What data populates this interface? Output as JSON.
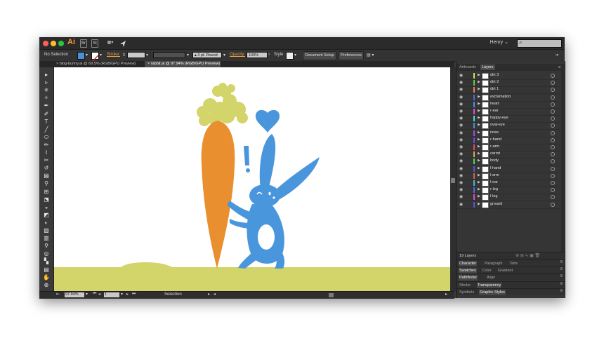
{
  "app": {
    "logo": "Ai",
    "user": "Henry",
    "user_chevron": "⌄",
    "search_icon": "search-icon",
    "window_controls": {
      "close": "#ff5f57",
      "minimize": "#febc2e",
      "zoom": "#28c840"
    },
    "menu_buttons": [
      "Br",
      "St",
      "▦▾"
    ]
  },
  "control_bar": {
    "selection": "No Selection",
    "stroke_label": "Stroke:",
    "stroke_width": "",
    "brush_label": "3 pt. Round",
    "opacity_label": "Opacity:",
    "opacity_value": "100%",
    "style_label": "Style",
    "doc_setup": "Document Setup",
    "preferences": "Preferences",
    "fill_color": "#4a90d9"
  },
  "tabs": [
    {
      "label": "blog-bunny.ai @ 69.5% (RGB/GPU Preview)",
      "active": false
    },
    {
      "label": "rabbit.ai @ 97.94% (RGB/GPU Preview)",
      "active": true
    }
  ],
  "tools": [
    "▸",
    "▹",
    "✳",
    "✧",
    "✒",
    "✐",
    "T",
    "╱",
    "⬭",
    "✏",
    "⌇",
    "✂",
    "↺",
    "▤",
    "⚲",
    "⊞",
    "⬔",
    "◒",
    "◩",
    "◐",
    "▧",
    "▥",
    "⚲",
    "◎",
    "▚",
    "▤",
    "✋",
    "⊕"
  ],
  "status": {
    "zoom": "97.94%",
    "page": "1",
    "selection_tool": "Selection"
  },
  "panel": {
    "tabs": [
      "Artboards",
      "Layers"
    ],
    "active_tab": "Layers",
    "layers": [
      {
        "name": "dirt 3",
        "color": "#d8e04a"
      },
      {
        "name": "dirt 2",
        "color": "#56d14a"
      },
      {
        "name": "dirt 1",
        "color": "#e0844a"
      },
      {
        "name": "exclamation",
        "color": "#4a6ad8"
      },
      {
        "name": "heart",
        "color": "#4a90d9"
      },
      {
        "name": "r-ear",
        "color": "#e04ad8"
      },
      {
        "name": "happy-eye",
        "color": "#4ad8d8"
      },
      {
        "name": "oval-eye",
        "color": "#4a90d9"
      },
      {
        "name": "nose",
        "color": "#a84ae0"
      },
      {
        "name": "r-hand",
        "color": "#6a4ae0"
      },
      {
        "name": "r-arm",
        "color": "#e04a6a"
      },
      {
        "name": "carrot",
        "color": "#e0a84a"
      },
      {
        "name": "body",
        "color": "#4ad85a"
      },
      {
        "name": "l-hand",
        "color": "#4a5ad8"
      },
      {
        "name": "l-arm",
        "color": "#d8604a"
      },
      {
        "name": "l-ear",
        "color": "#4ab0d8"
      },
      {
        "name": "r-leg",
        "color": "#4a6ad8"
      },
      {
        "name": "l-leg",
        "color": "#d84ac8"
      },
      {
        "name": "ground",
        "color": "#4a5ad8"
      }
    ],
    "count": "19 Layers",
    "rows": [
      [
        {
          "label": "Character",
          "active": true
        },
        {
          "label": "Paragraph",
          "active": false
        },
        {
          "label": "Tabs",
          "active": false
        }
      ],
      [
        {
          "label": "Swatches",
          "active": true
        },
        {
          "label": "Color",
          "active": false
        },
        {
          "label": "Gradient",
          "active": false
        }
      ],
      [
        {
          "label": "Pathfinder",
          "active": true
        },
        {
          "label": "Align",
          "active": false
        }
      ],
      [
        {
          "label": "Stroke",
          "active": false
        },
        {
          "label": "Transparency",
          "active": true
        }
      ],
      [
        {
          "label": "Symbols",
          "active": false
        },
        {
          "label": "Graphic Styles",
          "active": true
        }
      ]
    ]
  },
  "artwork": {
    "ground_color": "#d3d46a",
    "carrot_color": "#e98f2f",
    "leaf_color": "#d3d46a",
    "bunny_color": "#4a96dc",
    "heart_color": "#4a96dc",
    "exclamation_color": "#4a96dc"
  }
}
